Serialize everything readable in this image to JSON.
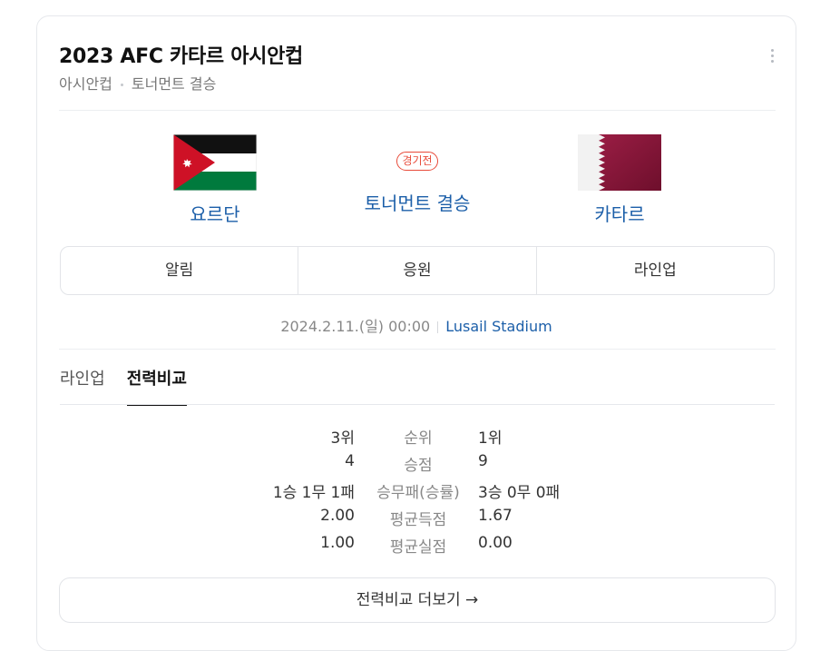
{
  "header": {
    "title": "2023 AFC 카타르 아시안컵",
    "breadcrumb": [
      "아시안컵",
      "토너먼트 결승"
    ]
  },
  "match": {
    "home": {
      "name": "요르단",
      "flag": "jordan-flag"
    },
    "away": {
      "name": "카타르",
      "flag": "qatar-flag"
    },
    "status_badge": "경기전",
    "stage": "토너먼트 결승",
    "datetime": "2024.2.11.(일) 00:00",
    "stadium": "Lusail Stadium"
  },
  "action_tabs": [
    "알림",
    "응원",
    "라인업"
  ],
  "sub_tabs": [
    {
      "label": "라인업",
      "active": false
    },
    {
      "label": "전력비교",
      "active": true
    }
  ],
  "comparison": [
    {
      "label": "순위",
      "home": "3위",
      "away": "1위"
    },
    {
      "label": "승점",
      "home": "4",
      "away": "9"
    },
    {
      "label": "승무패(승률)",
      "home": "1승 1무 1패",
      "away": "3승 0무 0패"
    },
    {
      "label": "평균득점",
      "home": "2.00",
      "away": "1.67"
    },
    {
      "label": "평균실점",
      "home": "1.00",
      "away": "0.00"
    }
  ],
  "more_button": "전력비교 더보기",
  "colors": {
    "link": "#1c5fa9",
    "badge": "#e84b3a",
    "qatar_maroon": "#8a1538",
    "jordan_red": "#ce1126",
    "jordan_green": "#007a3d"
  }
}
